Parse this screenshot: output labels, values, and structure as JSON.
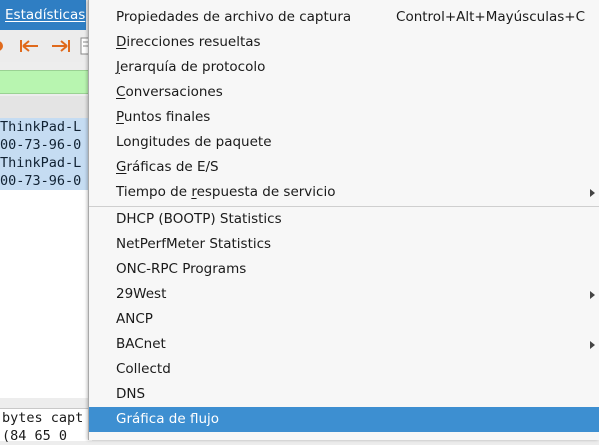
{
  "menu_title": "Estadísticas",
  "packet_rows": [
    "ThinkPad-L",
    "00-73-96-0",
    "ThinkPad-L",
    "00-73-96-0"
  ],
  "detail_lines": [
    "bytes capt",
    "(84 65 0"
  ],
  "menu": {
    "items_group1": [
      {
        "label": "Propiedades de archivo de captura",
        "shortcut": "Control+Alt+Mayúsculas+C"
      },
      {
        "pre": "",
        "u": "D",
        "post": "irecciones resueltas"
      },
      {
        "pre": "",
        "u": "J",
        "post": "erarquía de protocolo"
      },
      {
        "pre": "",
        "u": "C",
        "post": "onversaciones"
      },
      {
        "pre": "",
        "u": "P",
        "post": "untos finales"
      },
      {
        "label": "Longitudes de paquete"
      },
      {
        "pre": "",
        "u": "G",
        "post": "ráficas de E/S"
      },
      {
        "pre": "Tiempo de ",
        "u": "r",
        "post": "espuesta de servicio",
        "submenu": true
      }
    ],
    "items_group2": [
      {
        "label": "DHCP (BOOTP) Statistics"
      },
      {
        "label": "NetPerfMeter Statistics"
      },
      {
        "label": "ONC-RPC Programs"
      },
      {
        "label": "29West",
        "submenu": true
      },
      {
        "label": "ANCP"
      },
      {
        "label": "BACnet",
        "submenu": true
      },
      {
        "label": "Collectd"
      },
      {
        "label": "DNS"
      },
      {
        "label": "Gráfica de flujo",
        "highlighted": true
      }
    ]
  }
}
